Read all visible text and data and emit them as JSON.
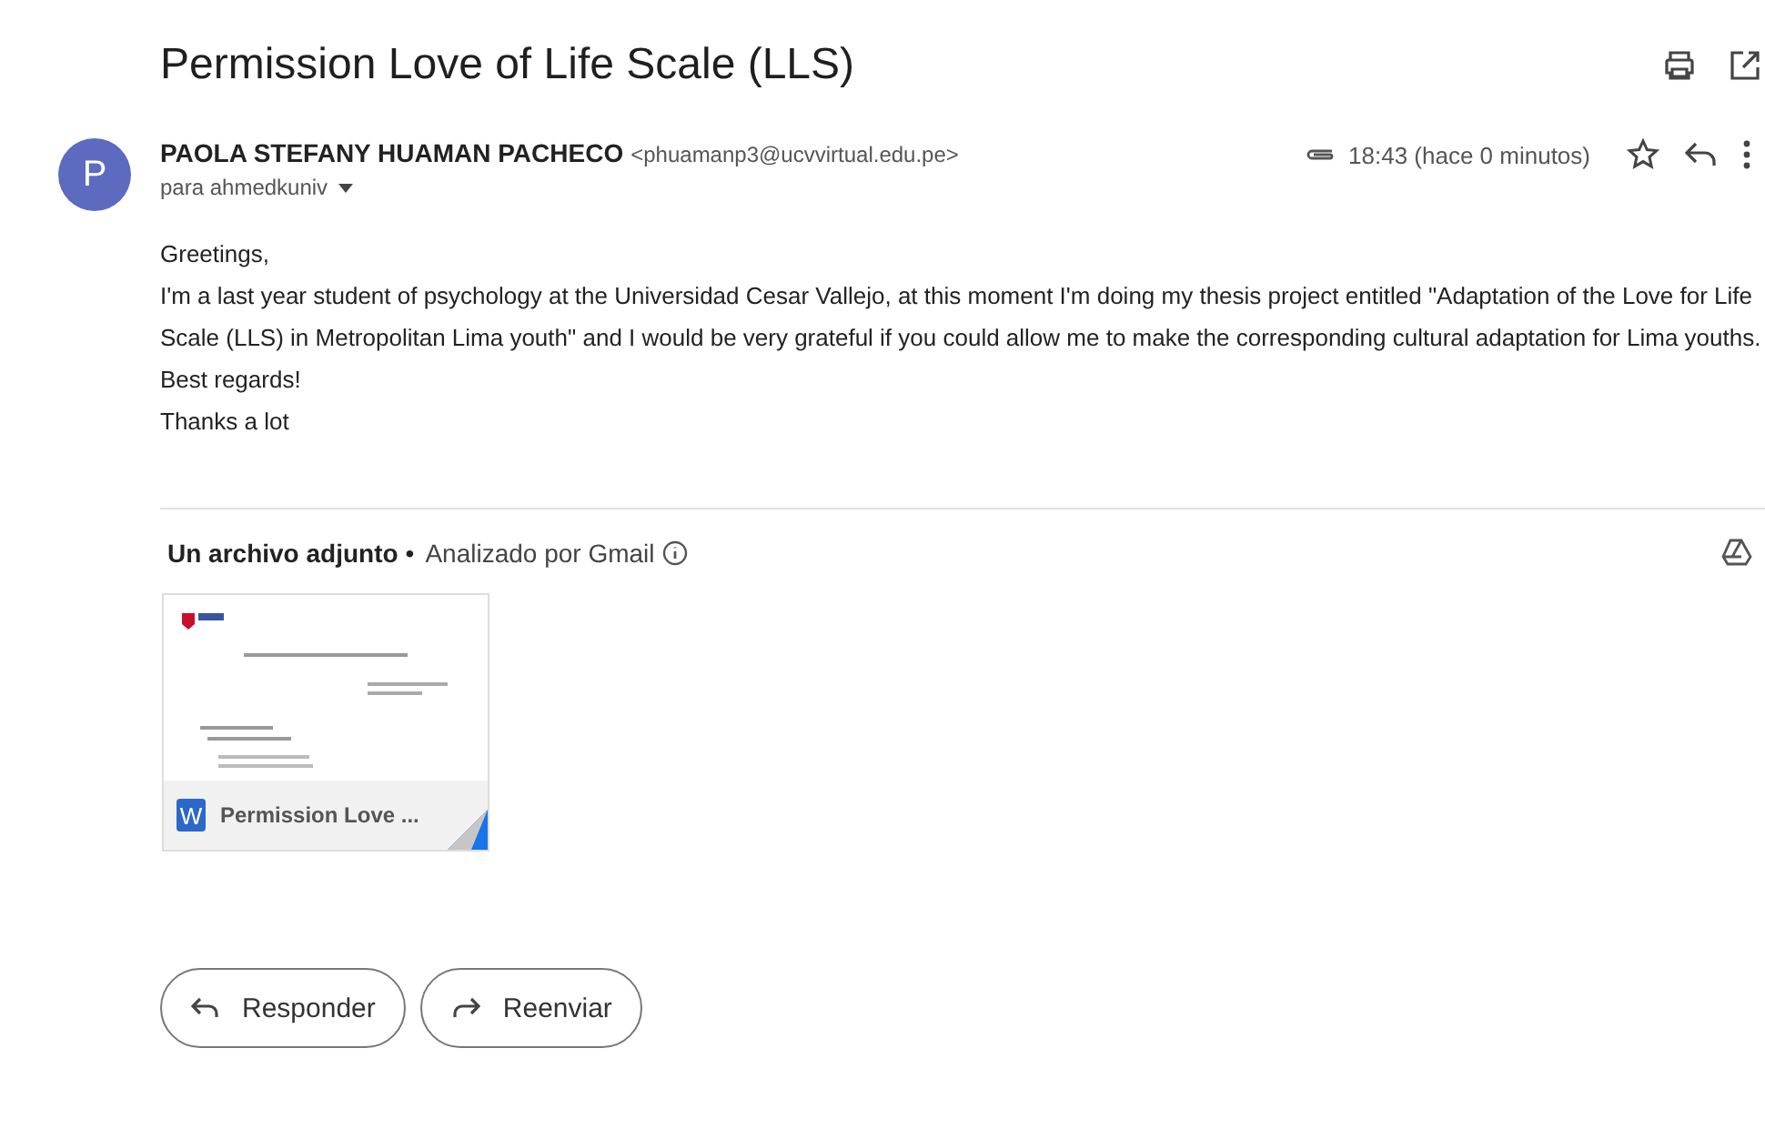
{
  "subject": "Permission Love of Life Scale (LLS)",
  "sender": {
    "avatar_letter": "P",
    "name": "PAOLA STEFANY HUAMAN PACHECO",
    "email": "<phuamanp3@ucvvirtual.edu.pe>",
    "recipient": "para ahmedkuniv",
    "time": "18:43 (hace 0 minutos)",
    "starred": false
  },
  "body": [
    "Greetings,",
    "I'm a last year student of psychology at the Universidad Cesar Vallejo, at this moment I'm doing my thesis project entitled \"Adaptation of the Love for Life Scale (LLS) in Metropolitan Lima youth\" and I would be very grateful if you could allow me to make the corresponding cultural adaptation for Lima youths.",
    "Best regards!",
    "Thanks a lot"
  ],
  "attachments": {
    "heading": "Un archivo adjunto",
    "separator": "•",
    "scan_note": "Analizado por Gmail",
    "files": [
      {
        "badge": "W",
        "name": "Permission Love ..."
      }
    ]
  },
  "actions": [
    "Responder",
    "Reenviar"
  ]
}
